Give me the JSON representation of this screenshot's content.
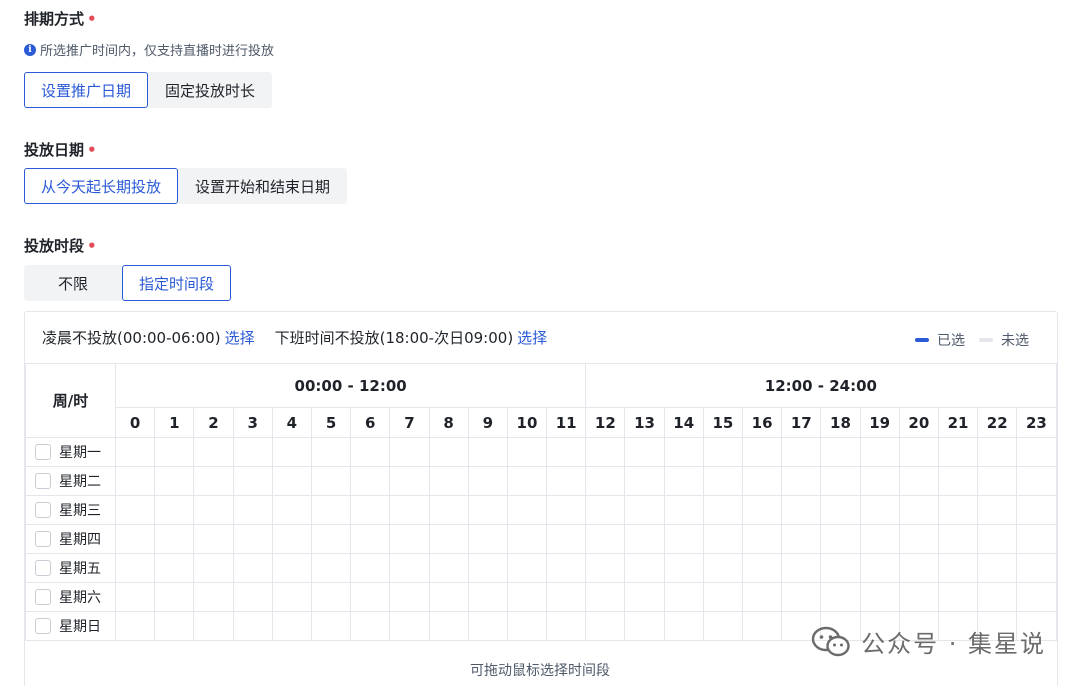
{
  "schedule_mode": {
    "title": "排期方式",
    "required_mark": "•",
    "hint_icon": "i",
    "hint": "所选推广时间内，仅支持直播时进行投放",
    "options": [
      "设置推广日期",
      "固定投放时长"
    ],
    "selected": "设置推广日期"
  },
  "delivery_date": {
    "title": "投放日期",
    "required_mark": "•",
    "options": [
      "从今天起长期投放",
      "设置开始和结束日期"
    ],
    "selected": "从今天起长期投放"
  },
  "delivery_period": {
    "title": "投放时段",
    "required_mark": "•",
    "options": [
      "不限",
      "指定时间段"
    ],
    "selected": "指定时间段"
  },
  "panel": {
    "quick1_text": "凌晨不投放(00:00-06:00)",
    "quick1_link": "选择",
    "quick2_text": "下班时间不投放(18:00-次日09:00)",
    "quick2_link": "选择",
    "legend_selected": "已选",
    "legend_unselected": "未选",
    "corner_label": "周/时",
    "half1": "00:00 - 12:00",
    "half2": "12:00 - 24:00",
    "hours": [
      "0",
      "1",
      "2",
      "3",
      "4",
      "5",
      "6",
      "7",
      "8",
      "9",
      "10",
      "11",
      "12",
      "13",
      "14",
      "15",
      "16",
      "17",
      "18",
      "19",
      "20",
      "21",
      "22",
      "23"
    ],
    "days": [
      "星期一",
      "星期二",
      "星期三",
      "星期四",
      "星期五",
      "星期六",
      "星期日"
    ],
    "footer": "可拖动鼠标选择时间段"
  },
  "colors": {
    "accent": "#2a5ad6",
    "required": "#e34d59",
    "border": "#e5e6eb"
  },
  "watermark": "公众号 · 集星说"
}
